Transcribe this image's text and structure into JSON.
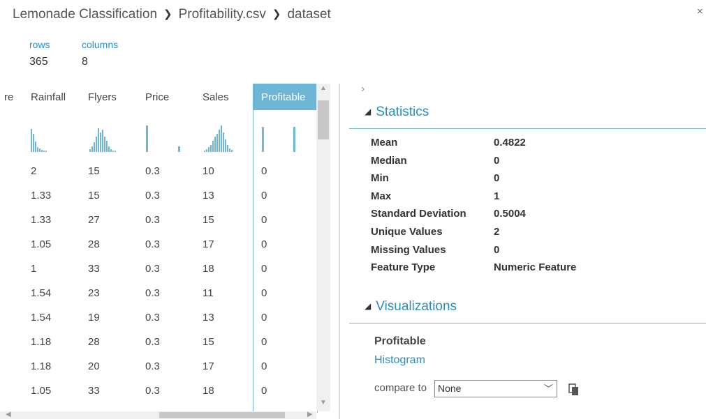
{
  "breadcrumb": [
    "Lemonade Classification",
    "Profitability.csv",
    "dataset"
  ],
  "breadcrumb_sep": "❯",
  "close_label": "×",
  "meta": {
    "rows_label": "rows",
    "rows_value": "365",
    "columns_label": "columns",
    "columns_value": "8"
  },
  "table": {
    "columns": [
      "re",
      "Rainfall",
      "Flyers",
      "Price",
      "Sales",
      "Profitable"
    ],
    "selected_column": "Profitable",
    "rows": [
      [
        "2",
        "15",
        "0.3",
        "10",
        "0"
      ],
      [
        "1.33",
        "15",
        "0.3",
        "13",
        "0"
      ],
      [
        "1.33",
        "27",
        "0.3",
        "15",
        "0"
      ],
      [
        "1.05",
        "28",
        "0.3",
        "17",
        "0"
      ],
      [
        "1",
        "33",
        "0.3",
        "18",
        "0"
      ],
      [
        "1.54",
        "23",
        "0.3",
        "11",
        "0"
      ],
      [
        "1.54",
        "19",
        "0.3",
        "13",
        "0"
      ],
      [
        "1.18",
        "28",
        "0.3",
        "15",
        "0"
      ],
      [
        "1.18",
        "20",
        "0.3",
        "17",
        "0"
      ],
      [
        "1.05",
        "33",
        "0.3",
        "18",
        "0"
      ]
    ]
  },
  "panel": {
    "expand_icon": "chevron-right-icon",
    "statistics_title": "Statistics",
    "statistics": [
      {
        "label": "Mean",
        "value": "0.4822"
      },
      {
        "label": "Median",
        "value": "0"
      },
      {
        "label": "Min",
        "value": "0"
      },
      {
        "label": "Max",
        "value": "1"
      },
      {
        "label": "Standard Deviation",
        "value": "0.5004"
      },
      {
        "label": "Unique Values",
        "value": "2"
      },
      {
        "label": "Missing Values",
        "value": "0"
      },
      {
        "label": "Feature Type",
        "value": "Numeric Feature"
      }
    ],
    "visualizations_title": "Visualizations",
    "viz_feature": "Profitable",
    "viz_link": "Histogram",
    "compare_label": "compare to",
    "compare_value": "None"
  },
  "colors": {
    "accent": "#2a8fbd",
    "selected_header": "#6fb5d6",
    "histogram_bar": "#6fb5d6"
  }
}
